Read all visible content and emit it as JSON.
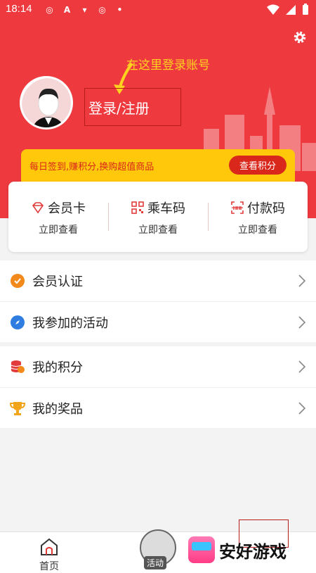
{
  "status_bar": {
    "time": "18:14"
  },
  "header": {
    "annotation": "在这里登录账号",
    "login_label": "登录/注册",
    "checkin_text": "每日签到,赚积分,换购超值商品",
    "points_button": "查看积分"
  },
  "cards": [
    {
      "title": "会员卡",
      "sub": "立即查看",
      "icon": "diamond-icon"
    },
    {
      "title": "乘车码",
      "sub": "立即查看",
      "icon": "qr-code-icon"
    },
    {
      "title": "付款码",
      "sub": "立即查看",
      "icon": "barcode-icon"
    }
  ],
  "menu": [
    {
      "label": "会员认证",
      "icon": "verified-icon"
    },
    {
      "label": "我参加的活动",
      "icon": "compass-icon"
    },
    {
      "label": "我的积分",
      "icon": "coins-icon"
    },
    {
      "label": "我的奖品",
      "icon": "trophy-icon"
    }
  ],
  "bottom_nav": {
    "home": "首页",
    "activity": "活动"
  },
  "watermark": "安好游戏",
  "colors": {
    "brand_red": "#ee3a3f",
    "accent_yellow": "#ffc80a",
    "text_red": "#d9271b"
  }
}
